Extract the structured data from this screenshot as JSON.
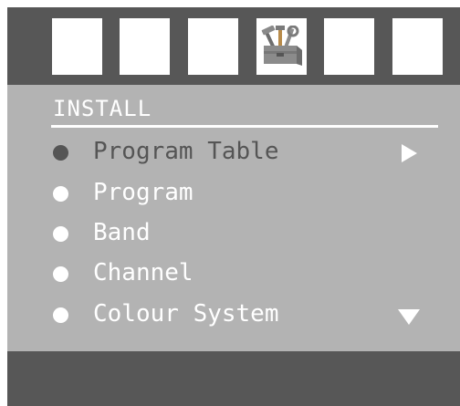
{
  "tabs": [
    {
      "icon": "blank-tab-icon",
      "active": false
    },
    {
      "icon": "blank-tab-icon",
      "active": false
    },
    {
      "icon": "blank-tab-icon",
      "active": false
    },
    {
      "icon": "toolbox-icon",
      "active": true
    },
    {
      "icon": "blank-tab-icon",
      "active": false
    },
    {
      "icon": "blank-tab-icon",
      "active": false
    }
  ],
  "menu": {
    "title": "INSTALL",
    "items": [
      {
        "label": "Program Table",
        "selected": true,
        "indicator": "arrow-right"
      },
      {
        "label": "Program",
        "selected": false
      },
      {
        "label": "Band",
        "selected": false
      },
      {
        "label": "Channel",
        "selected": false
      },
      {
        "label": "Colour System",
        "selected": false,
        "indicator": "arrow-down"
      }
    ]
  },
  "colors": {
    "frame": "#575757",
    "panel": "#b3b3b3",
    "text": "#ffffff",
    "selected_text": "#555555"
  }
}
